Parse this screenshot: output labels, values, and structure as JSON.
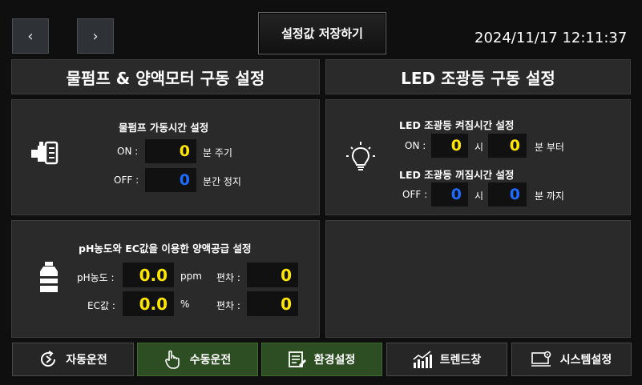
{
  "header": {
    "prev_label": "‹",
    "next_label": "›",
    "save_label": "설정값 저장하기",
    "datetime": "2024/11/17 12:11:37"
  },
  "sections": {
    "pump_title": "물펌프 & 양액모터 구동 설정",
    "led_title": "LED 조광등 구동 설정"
  },
  "pump": {
    "heading": "물펌프 가동시간 설정",
    "on_label": "ON :",
    "on_value": "0",
    "on_unit": "분 주기",
    "off_label": "OFF :",
    "off_value": "0",
    "off_unit": "분간 정지"
  },
  "led": {
    "on_heading": "LED 조광등 켜짐시간 설정",
    "on_label": "ON :",
    "on_hour": "0",
    "on_hour_unit": "시",
    "on_min": "0",
    "on_min_unit": "분 부터",
    "off_heading": "LED 조광등 꺼짐시간 설정",
    "off_label": "OFF :",
    "off_hour": "0",
    "off_hour_unit": "시",
    "off_min": "0",
    "off_min_unit": "분 까지"
  },
  "nutrient": {
    "heading": "pH농도와 EC값을 이용한 양액공급 설정",
    "ph_label": "pH농도 :",
    "ph_value": "0.0",
    "ph_unit": "ppm",
    "ph_dev_label": "편차 :",
    "ph_dev_value": "0",
    "ec_label": "EC값 :",
    "ec_value": "0.0",
    "ec_unit": "%",
    "ec_dev_label": "편차 :",
    "ec_dev_value": "0"
  },
  "bottom_nav": {
    "auto": "자동운전",
    "manual": "수동운전",
    "env": "환경설정",
    "trend": "트렌드창",
    "system": "시스템설정"
  },
  "colors": {
    "value_yellow": "#ffe600",
    "value_blue": "#1e6bff",
    "active_green": "#2d4e22"
  }
}
